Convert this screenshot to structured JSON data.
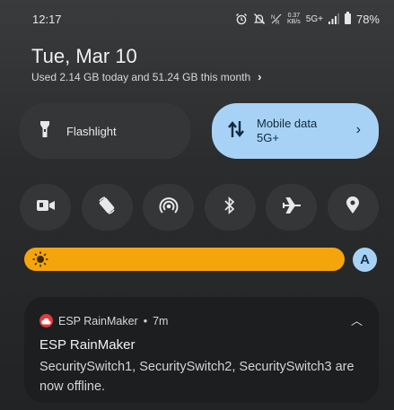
{
  "status_bar": {
    "time": "12:17",
    "data_speed_value": "0.37",
    "data_speed_unit": "KB/s",
    "network": "5G+",
    "battery": "78%",
    "icons": [
      "alarm-icon",
      "notifications-off-icon",
      "nr-icon",
      "signal-icon",
      "battery-icon"
    ]
  },
  "header": {
    "date": "Tue, Mar 10",
    "usage": "Used 2.14 GB today and 51.24 GB this month"
  },
  "tiles": {
    "flashlight": {
      "label": "Flashlight",
      "active": false
    },
    "mobile_data": {
      "label": "Mobile data",
      "sublabel": "5G+",
      "active": true
    }
  },
  "quick_toggles": [
    "camera-icon",
    "auto-rotate-icon",
    "hotspot-icon",
    "bluetooth-icon",
    "airplane-icon",
    "location-icon"
  ],
  "brightness": {
    "auto_label": "A",
    "level": 1.0
  },
  "notification": {
    "app": "ESP RainMaker",
    "separator": "•",
    "time": "7m",
    "title": "ESP RainMaker",
    "body": "SecuritySwitch1, SecuritySwitch2, SecuritySwitch3 are now offline."
  },
  "colors": {
    "accent": "#a8d2f5",
    "brightness": "#f5a50c",
    "app_icon": "#e23b3b"
  }
}
